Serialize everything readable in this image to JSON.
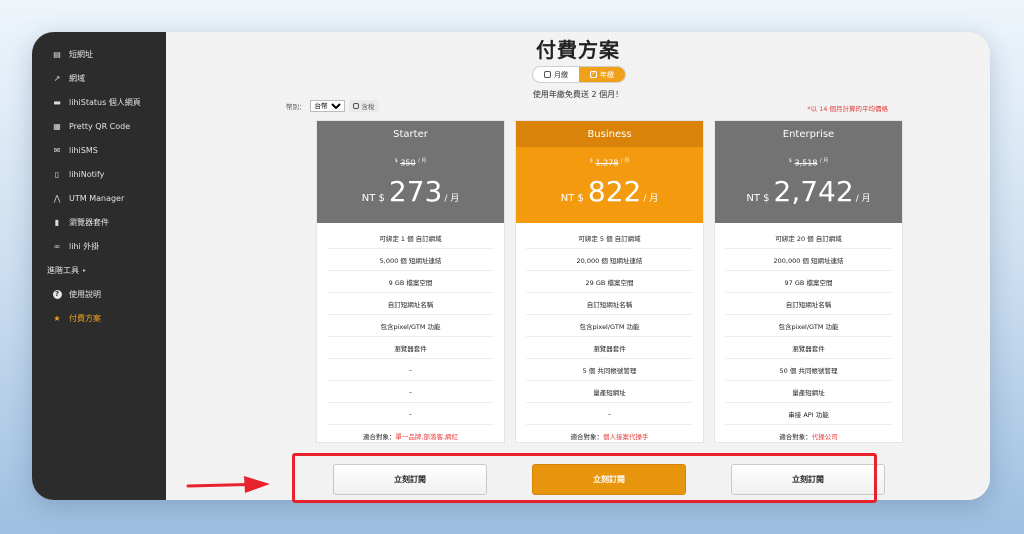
{
  "sidebar": {
    "items": [
      {
        "icon": "document-icon",
        "glyph": "▤",
        "label": "短網址"
      },
      {
        "icon": "external-link-icon",
        "glyph": "↗",
        "label": "網域"
      },
      {
        "icon": "card-icon",
        "glyph": "▬",
        "label": "lihiStatus 個人網頁"
      },
      {
        "icon": "qr-code-icon",
        "glyph": "▦",
        "label": "Pretty QR Code"
      },
      {
        "icon": "mail-icon",
        "glyph": "✉",
        "label": "lihiSMS"
      },
      {
        "icon": "phone-icon",
        "glyph": "▯",
        "label": "lihiNotify"
      },
      {
        "icon": "utm-icon",
        "glyph": "⋀",
        "label": "UTM Manager"
      },
      {
        "icon": "bookmark-icon",
        "glyph": "▮",
        "label": "瀏覽器套件"
      },
      {
        "icon": "link-icon",
        "glyph": "∞",
        "label": "lihi 外掛"
      }
    ],
    "section_label": "進階工具",
    "section_caret": "▸",
    "help": {
      "glyph": "?",
      "label": "使用說明"
    },
    "pricing": {
      "glyph": "★",
      "label": "付費方案"
    }
  },
  "page": {
    "title": "付費方案",
    "toggle": {
      "monthly": "月繳",
      "yearly": "年繳",
      "check": "✓"
    },
    "promo": "使用年繳免費送 2 個月！",
    "currency_label": "幣別：",
    "currency_value": "台幣",
    "tax_label": "含稅",
    "note": "*以 14 個月計算的平均價格"
  },
  "plans": [
    {
      "name": "Starter",
      "color": "#737373",
      "old_prefix": "$",
      "old_price": "350",
      "old_suffix": "/ 月",
      "nt": "NT $",
      "price": "273",
      "per": "/ 月",
      "features": [
        "可綁定 1 個 自訂網域",
        "5,000 個 短網址連結",
        "9 GB 檔案空間",
        "自訂短網址名稱",
        "包含pixel/GTM 功能",
        "瀏覽器套件",
        "–",
        "–",
        "–"
      ],
      "target_label": "適合對象：",
      "target": "單一品牌,部落客,網紅",
      "button": "立刻訂閱"
    },
    {
      "name": "Business",
      "color": "#f39a0e",
      "head_color": "#d9830a",
      "old_prefix": "$",
      "old_price": "1,278",
      "old_suffix": "/ 月",
      "nt": "NT $",
      "price": "822",
      "per": "/ 月",
      "features": [
        "可綁定 5 個 自訂網域",
        "20,000 個 短網址連結",
        "29 GB 檔案空間",
        "自訂短網址名稱",
        "包含pixel/GTM 功能",
        "瀏覽器套件",
        "5 個 共同帳號管理",
        "量產短網址",
        "–"
      ],
      "target_label": "適合對象：",
      "target": "個人接案代操手",
      "button": "立刻訂閱"
    },
    {
      "name": "Enterprise",
      "color": "#737373",
      "old_prefix": "$",
      "old_price": "3,518",
      "old_suffix": "/ 月",
      "nt": "NT $",
      "price": "2,742",
      "per": "/ 月",
      "features": [
        "可綁定 20 個 自訂網域",
        "200,000 個 短網址連結",
        "97 GB 檔案空間",
        "自訂短網址名稱",
        "包含pixel/GTM 功能",
        "瀏覽器套件",
        "50 個 共同帳號管理",
        "量產短網址",
        "串接 API 功能"
      ],
      "target_label": "適合對象：",
      "target": "代操公司",
      "button": "立刻訂閱"
    }
  ]
}
